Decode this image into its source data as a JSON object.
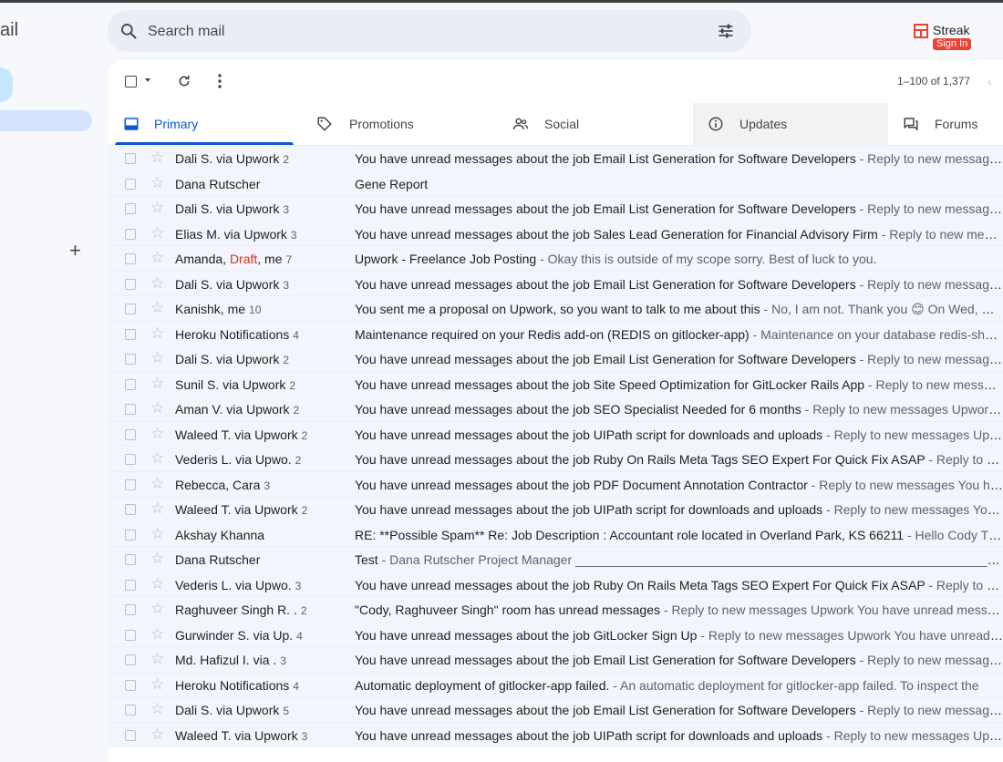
{
  "app": {
    "logo_text": "ail"
  },
  "search": {
    "placeholder": "Search mail"
  },
  "streak": {
    "name": "Streak",
    "signin": "Sign In"
  },
  "toolbar": {
    "pagination": "1–100 of 1,377"
  },
  "tabs": [
    {
      "label": "Primary",
      "icon": "inbox-icon",
      "active": true
    },
    {
      "label": "Promotions",
      "icon": "tag-icon"
    },
    {
      "label": "Social",
      "icon": "people-icon"
    },
    {
      "label": "Updates",
      "icon": "info-icon"
    },
    {
      "label": "Forums",
      "icon": "forum-icon"
    }
  ],
  "colors": {
    "accent": "#0b57d0",
    "row_bg": "#f2f6fc",
    "compose": "#c2e7ff",
    "streak_red": "#ea4335"
  },
  "emails": [
    {
      "sender": "Dali S. via Upwork",
      "count": "2",
      "subject": "You have unread messages about the job Email List Generation for Software Developers",
      "snippet": "Reply to new messages Upwork You have unread messages"
    },
    {
      "sender": "Dana Rutscher",
      "count": "",
      "subject": "Gene Report",
      "snippet": ""
    },
    {
      "sender": "Dali S. via Upwork",
      "count": "3",
      "subject": "You have unread messages about the job Email List Generation for Software Developers",
      "snippet": "Reply to new messages Upwork You have unread messages"
    },
    {
      "sender": "Elias M. via Upwork",
      "count": "3",
      "subject": "You have unread messages about the job Sales Lead Generation for Financial Advisory Firm",
      "snippet": "Reply to new messages Upwork You have unread"
    },
    {
      "sender_before": "Amanda, ",
      "sender_draft": "Draft",
      "sender_after": ", me",
      "count": "7",
      "subject": "Upwork - Freelance Job Posting",
      "snippet": "Okay this is outside of my scope sorry. Best of luck to you."
    },
    {
      "sender": "Dali S. via Upwork",
      "count": "3",
      "subject": "You have unread messages about the job Email List Generation for Software Developers",
      "snippet": "Reply to new messages Upwork You have unread messages"
    },
    {
      "sender": "Kanishk, me",
      "count": "10",
      "subject": "You sent me a proposal on Upwork, so you want to talk to me about this",
      "snippet": "No, I am not. Thank you 😊 On Wed, Nov"
    },
    {
      "sender": "Heroku Notifications",
      "count": "4",
      "subject": "Maintenance required on your Redis add-on (REDIS on gitlocker-app)",
      "snippet": "Maintenance on your database redis-shallow"
    },
    {
      "sender": "Dali S. via Upwork",
      "count": "2",
      "subject": "You have unread messages about the job Email List Generation for Software Developers",
      "snippet": "Reply to new messages Upwork You have unread messages"
    },
    {
      "sender": "Sunil S. via Upwork",
      "count": "2",
      "subject": "You have unread messages about the job Site Speed Optimization for GitLocker Rails App",
      "snippet": "Reply to new messages Upwork"
    },
    {
      "sender": "Aman V. via Upwork",
      "count": "2",
      "subject": "You have unread messages about the job SEO Specialist Needed for 6 months",
      "snippet": "Reply to new messages Upwork You have unread"
    },
    {
      "sender": "Waleed T. via Upwork",
      "count": "2",
      "subject": "You have unread messages about the job UIPath script for downloads and uploads",
      "snippet": "Reply to new messages Upwork You have unread"
    },
    {
      "sender": "Vederis L. via Upwo.",
      "count": "2",
      "subject": "You have unread messages about the job Ruby On Rails Meta Tags SEO Expert For Quick Fix ASAP",
      "snippet": "Reply to new messages"
    },
    {
      "sender": "Rebecca, Cara",
      "count": "3",
      "subject": "You have unread messages about the job PDF Document Annotation Contractor",
      "snippet": "Reply to new messages You have unread"
    },
    {
      "sender": "Waleed T. via Upwork",
      "count": "2",
      "subject": "You have unread messages about the job UIPath script for downloads and uploads",
      "snippet": "Reply to new messages You have unread"
    },
    {
      "sender": "Akshay Khanna",
      "count": "",
      "subject": "RE: **Possible Spam** Re: Job Description : Accountant role located in Overland Park, KS 66211",
      "snippet": "Hello Cody This is"
    },
    {
      "sender": "Dana Rutscher",
      "count": "",
      "subject": "Test",
      "snippet": "Dana Rutscher Project Manager ________________________________________________________________"
    },
    {
      "sender": "Vederis L. via Upwo.",
      "count": "3",
      "subject": "You have unread messages about the job Ruby On Rails Meta Tags SEO Expert For Quick Fix ASAP",
      "snippet": "Reply to new messages"
    },
    {
      "sender": "Raghuveer Singh R. .",
      "count": "2",
      "subject": "\"Cody, Raghuveer Singh\" room has unread messages",
      "snippet": "Reply to new messages Upwork You have unread messages"
    },
    {
      "sender": "Gurwinder S. via Up.",
      "count": "4",
      "subject": "You have unread messages about the job GitLocker Sign Up",
      "snippet": "Reply to new messages Upwork You have unread messages"
    },
    {
      "sender": "Md. Hafizul I. via .",
      "count": "3",
      "subject": "You have unread messages about the job Email List Generation for Software Developers",
      "snippet": "Reply to new messages Upwork You have unread messages"
    },
    {
      "sender": "Heroku Notifications",
      "count": "4",
      "subject": "Automatic deployment of gitlocker-app failed.",
      "snippet": "An automatic deployment for gitlocker-app failed. To inspect the"
    },
    {
      "sender": "Dali S. via Upwork",
      "count": "5",
      "subject": "You have unread messages about the job Email List Generation for Software Developers",
      "snippet": "Reply to new messages Upwork You have unread messages"
    },
    {
      "sender": "Waleed T. via Upwork",
      "count": "3",
      "subject": "You have unread messages about the job UIPath script for downloads and uploads",
      "snippet": "Reply to new messages Upwork You have unread"
    }
  ]
}
